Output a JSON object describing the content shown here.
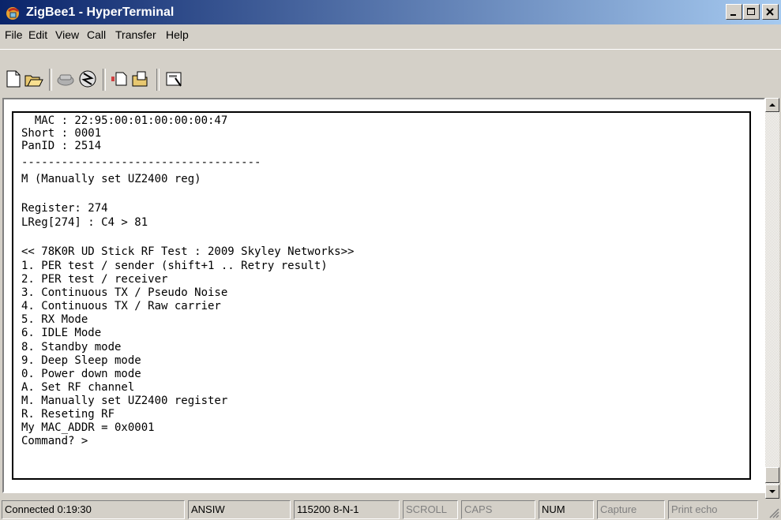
{
  "window": {
    "title": "ZigBee1 - HyperTerminal"
  },
  "menu": {
    "items": [
      "File",
      "Edit",
      "View",
      "Call",
      "Transfer",
      "Help"
    ]
  },
  "toolbar": {
    "buttons": [
      "new-icon",
      "open-icon",
      "disconnect-icon",
      "dial-icon",
      "send-icon",
      "receive-icon",
      "properties-icon"
    ]
  },
  "terminal": {
    "lines": [
      "  MAC : 22:95:00:01:00:00:00:47",
      "Short : 0001",
      "PanID : 2514",
      "------------------------------------",
      "M (Manually set UZ2400 reg)",
      "",
      "Register: 274",
      "LReg[274] : C4 > 81",
      "",
      "<< 78K0R UD Stick RF Test : 2009 Skyley Networks>>",
      "1. PER test / sender (shift+1 .. Retry result)",
      "2. PER test / receiver",
      "3. Continuous TX / Pseudo Noise",
      "4. Continuous TX / Raw carrier",
      "5. RX Mode",
      "6. IDLE Mode",
      "8. Standby mode",
      "9. Deep Sleep mode",
      "0. Power down mode",
      "A. Set RF channel",
      "M. Manually set UZ2400 register",
      "R. Reseting RF",
      "My MAC_ADDR = 0x0001",
      "Command? >"
    ]
  },
  "status": {
    "connected": "Connected 0:19:30",
    "emulation": "ANSIW",
    "port": "115200 8-N-1",
    "scroll": "SCROLL",
    "caps": "CAPS",
    "num": "NUM",
    "capture": "Capture",
    "print_echo": "Print echo"
  }
}
